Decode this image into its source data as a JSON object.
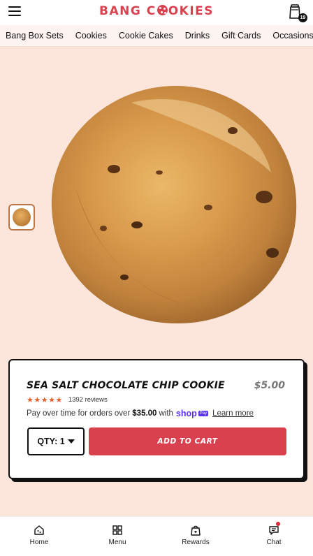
{
  "header": {
    "logo_prefix": "BANG C",
    "logo_suffix": "OKIES",
    "cart_count": "19"
  },
  "nav": {
    "items": [
      "Bang Box Sets",
      "Cookies",
      "Cookie Cakes",
      "Drinks",
      "Gift Cards",
      "Occasions"
    ]
  },
  "product": {
    "title": "SEA SALT CHOCOLATE CHIP COOKIE",
    "price": "$5.00",
    "stars": "★★★★★",
    "reviews": "1392 reviews",
    "pay_prefix": "Pay over time for orders over",
    "pay_amount": "$35.00",
    "pay_with": "with",
    "shop_text": "shop",
    "pay_text": "Pay",
    "learn_more": "Learn more",
    "qty_label": "QTY: 1",
    "add_to_cart": "ADD TO CART"
  },
  "bottom_nav": {
    "home": "Home",
    "menu": "Menu",
    "rewards": "Rewards",
    "chat": "Chat"
  },
  "colors": {
    "brand_red": "#d9414f",
    "background_pink": "#fce6dc",
    "star_orange": "#e8622c",
    "shop_purple": "#5a31f4"
  },
  "icons": {
    "menu": "hamburger-icon",
    "cart": "cart-icon",
    "home": "home-icon",
    "menu_grid": "grid-icon",
    "rewards": "rewards-bag-icon",
    "chat": "chat-icon"
  }
}
